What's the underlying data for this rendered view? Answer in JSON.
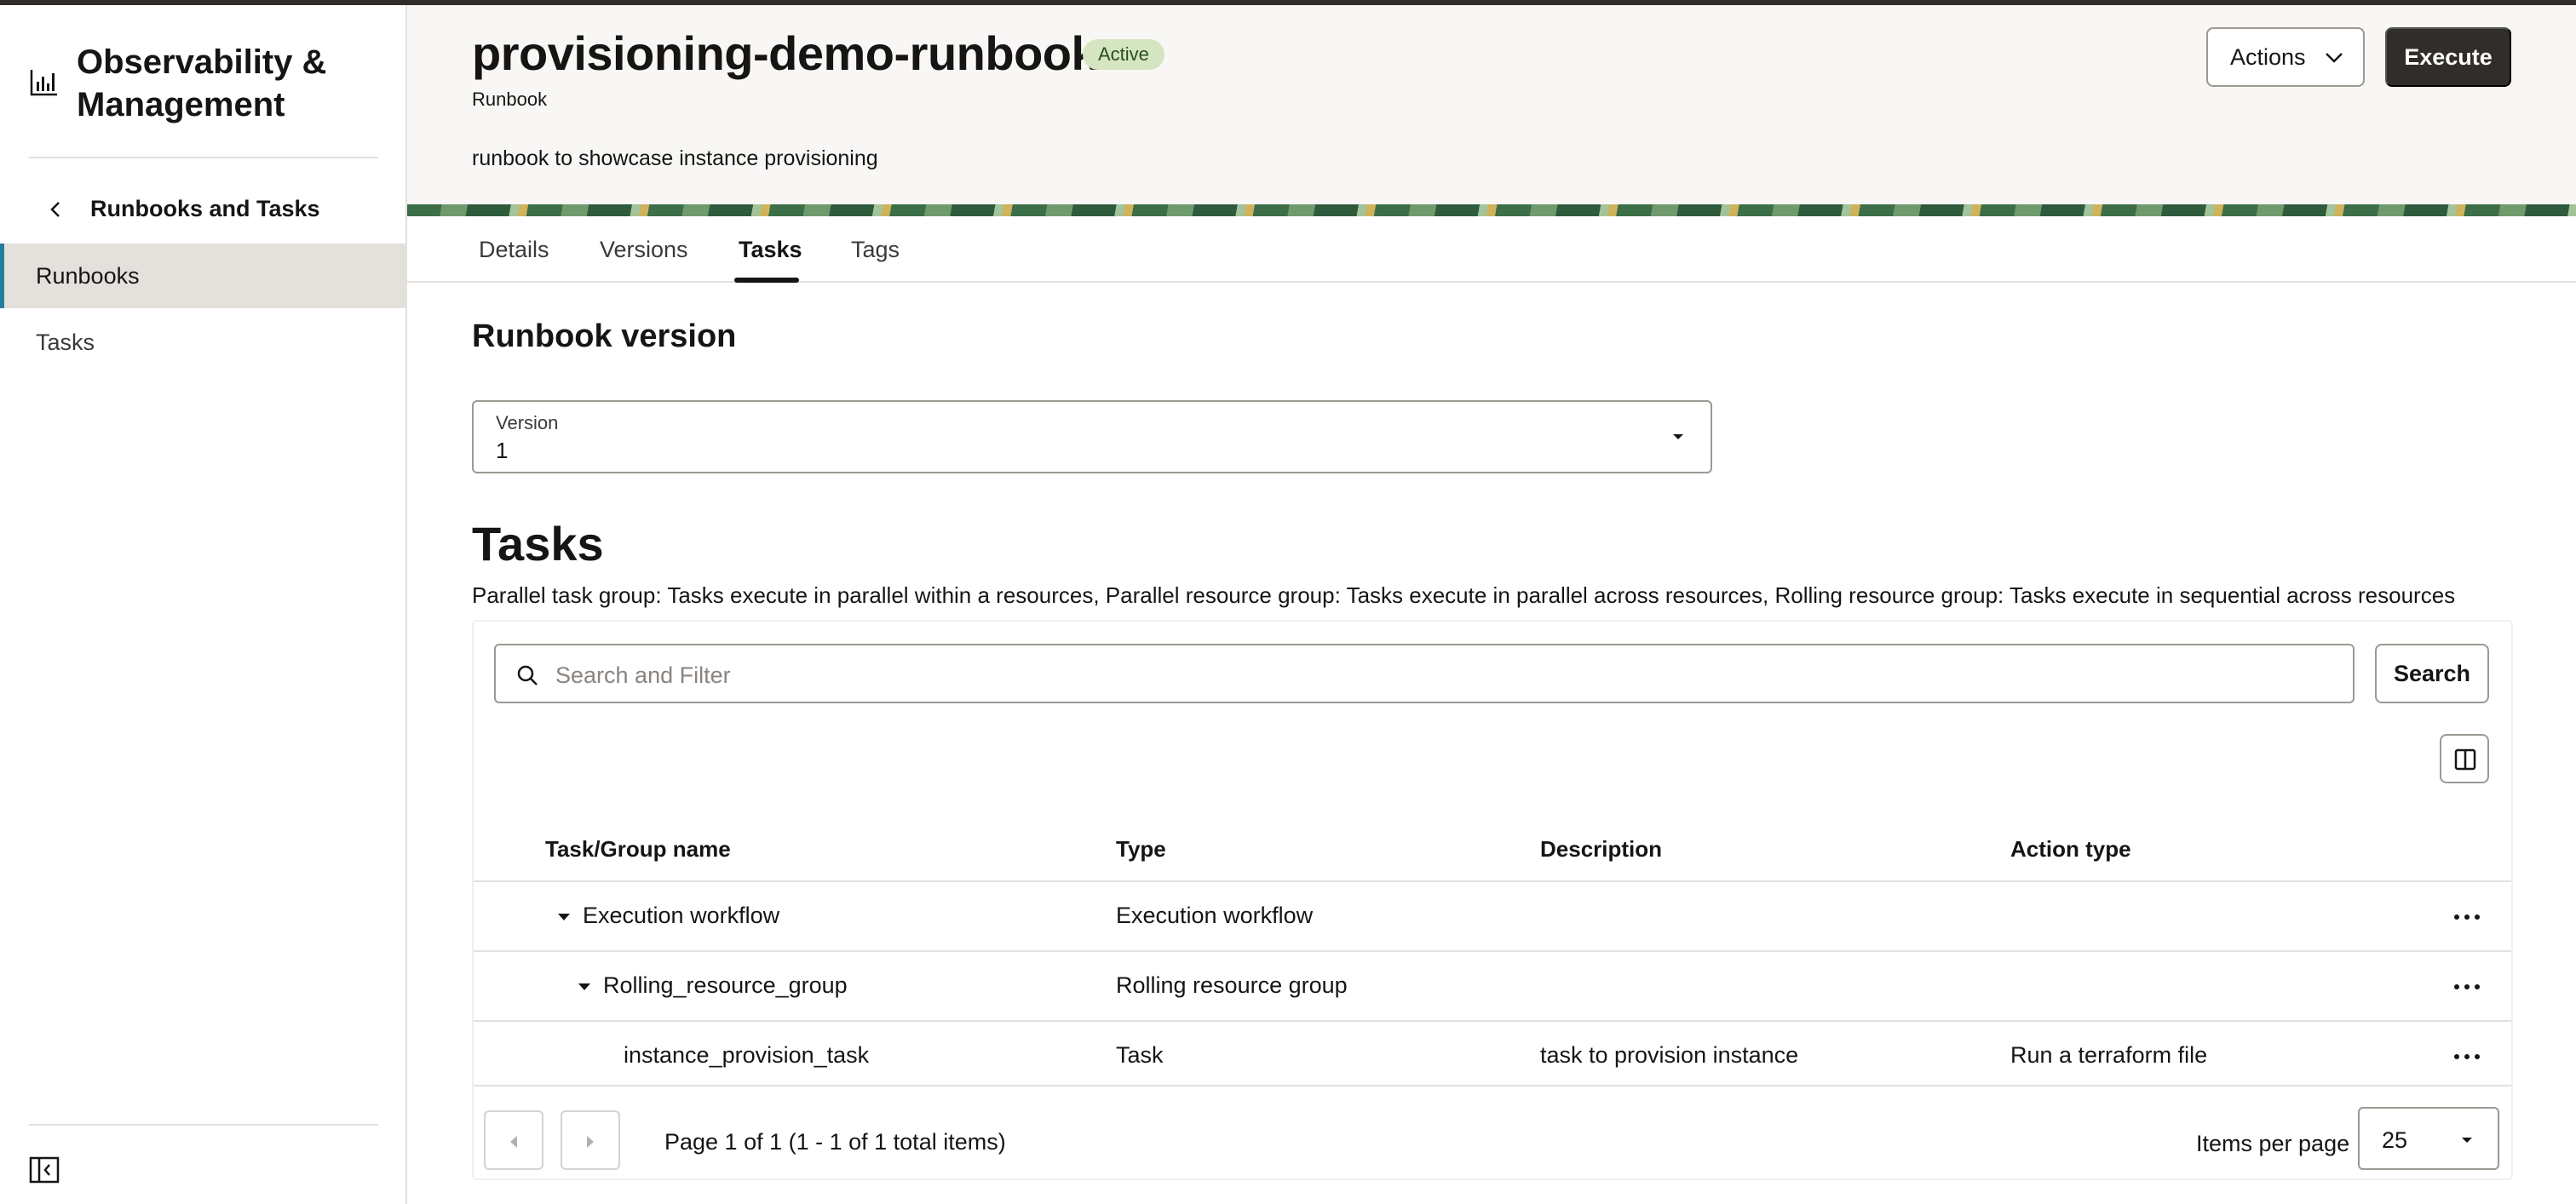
{
  "sidebar": {
    "app_title": "Observability & Management",
    "back_label": "Runbooks and Tasks",
    "items": [
      {
        "label": "Runbooks",
        "active": true
      },
      {
        "label": "Tasks",
        "active": false
      }
    ],
    "icons": {
      "brand": "chart-icon",
      "back": "chevron-left-icon",
      "collapse": "collapse-sidebar-icon"
    }
  },
  "header": {
    "title": "provisioning-demo-runbook",
    "status": "Active",
    "subtitle": "Runbook",
    "description": "runbook to showcase instance provisioning",
    "actions_label": "Actions",
    "execute_label": "Execute"
  },
  "tabs": [
    {
      "label": "Details",
      "active": false
    },
    {
      "label": "Versions",
      "active": false
    },
    {
      "label": "Tasks",
      "active": true
    },
    {
      "label": "Tags",
      "active": false
    }
  ],
  "runbook_version": {
    "title": "Runbook version",
    "field_label": "Version",
    "value": "1"
  },
  "tasks": {
    "title": "Tasks",
    "help_text": "Parallel task group: Tasks execute in parallel within a resources, Parallel resource group: Tasks execute in parallel across resources, Rolling resource group: Tasks execute in sequential across resources",
    "search_placeholder": "Search and Filter",
    "search_button": "Search",
    "columns": [
      "Task/Group name",
      "Type",
      "Description",
      "Action type"
    ],
    "rows": [
      {
        "name": "Execution workflow",
        "type": "Execution workflow",
        "description": "",
        "action_type": "",
        "level": 0,
        "expandable": true
      },
      {
        "name": "Rolling_resource_group",
        "type": "Rolling resource group",
        "description": "",
        "action_type": "",
        "level": 1,
        "expandable": true
      },
      {
        "name": "instance_provision_task",
        "type": "Task",
        "description": "task to provision instance",
        "action_type": "Run a terraform file",
        "level": 2,
        "expandable": false
      }
    ],
    "pagination": {
      "page_info": "Page 1 of 1 (1 - 1 of 1 total items)",
      "items_per_page_label": "Items per page",
      "items_per_page": "25"
    }
  },
  "colors": {
    "primary_button": "#312d2a",
    "active_nav": "#e4e1dd",
    "accent": "#227e9e",
    "status_badge_bg": "#d5e5c1"
  }
}
